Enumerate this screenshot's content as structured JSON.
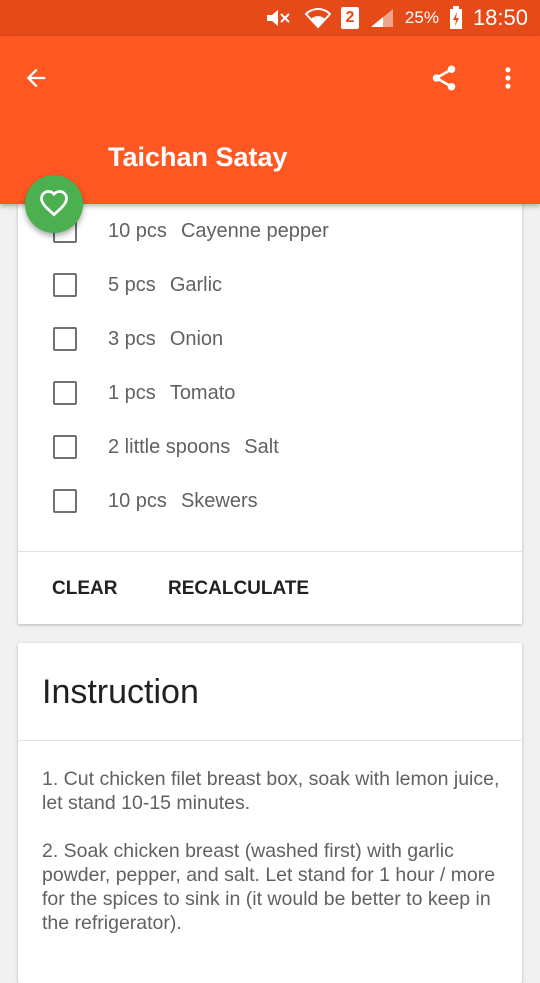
{
  "status_bar": {
    "sim_number": "2",
    "battery_percent": "25%",
    "time": "18:50",
    "icons": [
      "mute-icon",
      "wifi-icon",
      "signal-icon",
      "battery-charging-icon"
    ]
  },
  "app_bar": {
    "title": "Taichan Satay",
    "icons": [
      "arrow-back-icon",
      "share-icon",
      "more-vert-icon"
    ],
    "color": "#ff5722"
  },
  "fab": {
    "icon": "heart-outline-icon",
    "color": "#4caf50"
  },
  "ingredients": [
    {
      "qty": "10 pcs",
      "name": "Cayenne pepper"
    },
    {
      "qty": "5 pcs",
      "name": "Garlic"
    },
    {
      "qty": "3 pcs",
      "name": "Onion"
    },
    {
      "qty": "1 pcs",
      "name": "Tomato"
    },
    {
      "qty": "2 little spoons",
      "name": "Salt"
    },
    {
      "qty": "10 pcs",
      "name": "Skewers"
    }
  ],
  "actions": {
    "clear": "CLEAR",
    "recalculate": "RECALCULATE"
  },
  "instruction": {
    "heading": "Instruction",
    "steps": [
      "1. Cut chicken filet breast box, soak with lemon juice, let stand 10-15 minutes.",
      "2. Soak chicken breast (washed first) with garlic powder, pepper, and salt. Let stand for 1 hour / more for the spices to sink in (it would be better to keep in the refrigerator)."
    ]
  }
}
